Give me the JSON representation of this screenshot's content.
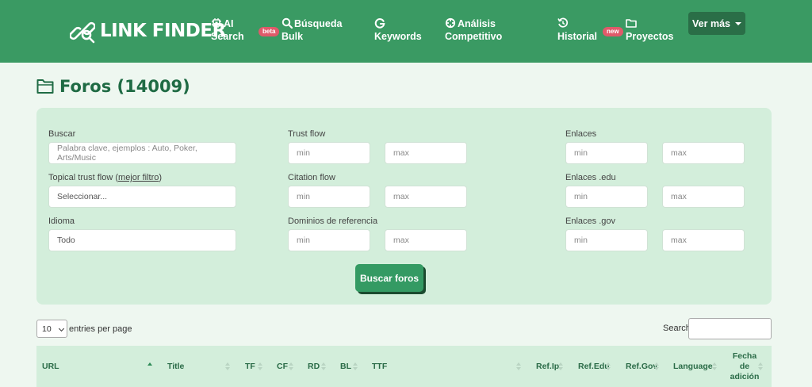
{
  "header": {
    "brand": "LINK FINDER",
    "nav": [
      {
        "line1": "AI",
        "line2": "Search",
        "icon": "chip-icon"
      },
      {
        "line1": "Búsqueda",
        "line2": "Bulk",
        "icon": "search-icon",
        "badge": "beta"
      },
      {
        "line1": "",
        "line2": "Keywords",
        "icon": "google-icon"
      },
      {
        "line1": "Análisis",
        "line2": "Competitivo",
        "icon": "crosshair-icon"
      },
      {
        "line1": "",
        "line2": "Historial",
        "icon": "history-icon"
      },
      {
        "line1": "",
        "line2": "Proyectos",
        "icon": "folder-icon",
        "badge": "new"
      }
    ],
    "more_label": "Ver más"
  },
  "page": {
    "title": "Foros (14009)"
  },
  "filters": {
    "buscar_label": "Buscar",
    "buscar_placeholder": "Palabra clave, ejemplos : Auto, Poker, Arts/Music",
    "topical_label": "Topical trust flow (",
    "topical_link": "mejor filtro",
    "topical_close": ")",
    "topical_value": "Seleccionar...",
    "idioma_label": "Idioma",
    "idioma_value": "Todo",
    "trust_flow_label": "Trust flow",
    "citation_flow_label": "Citation flow",
    "dominios_label": "Dominios de referencia",
    "enlaces_label": "Enlaces",
    "enlaces_edu_label": "Enlaces .edu",
    "enlaces_gov_label": "Enlaces .gov",
    "min_placeholder": "min",
    "max_placeholder": "max",
    "submit_label": "Buscar foros"
  },
  "table": {
    "page_size": "10",
    "entries_label": "entries per page",
    "search_label": "Search:",
    "columns": [
      "URL",
      "Title",
      "TF",
      "CF",
      "RD",
      "BL",
      "TTF",
      "Ref.Ip",
      "Ref.Edu",
      "Ref.Gov",
      "Language",
      "Fecha de adición"
    ],
    "sorted_column": "URL",
    "sort_direction": "ascending"
  },
  "colors": {
    "header_bg": "#3a9a63",
    "panel_bg": "#d3eedb",
    "page_bg": "#eef7f0",
    "title_color": "#1f6b44",
    "button_bg": "#349a63",
    "badge_bg": "#e05a6a"
  }
}
